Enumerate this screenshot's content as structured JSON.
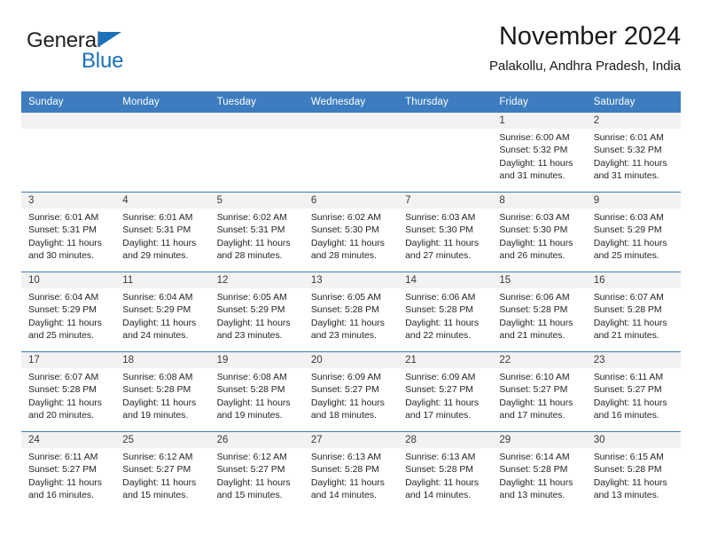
{
  "brand": {
    "name_part1": "General",
    "name_part2": "Blue",
    "triangle_icon": "triangle-icon",
    "color_dark": "#231f20",
    "color_blue": "#1b71b8"
  },
  "header": {
    "title": "November 2024",
    "subtitle": "Palakollu, Andhra Pradesh, India"
  },
  "theme": {
    "header_blue": "#3d7dbf",
    "daynum_band": "#f2f2f2",
    "text": "#262626"
  },
  "calendar": {
    "weekday_headers": [
      "Sunday",
      "Monday",
      "Tuesday",
      "Wednesday",
      "Thursday",
      "Friday",
      "Saturday"
    ],
    "weeks": [
      [
        {
          "day": "",
          "lines": []
        },
        {
          "day": "",
          "lines": []
        },
        {
          "day": "",
          "lines": []
        },
        {
          "day": "",
          "lines": []
        },
        {
          "day": "",
          "lines": []
        },
        {
          "day": "1",
          "lines": [
            "Sunrise: 6:00 AM",
            "Sunset: 5:32 PM",
            "Daylight: 11 hours",
            "and 31 minutes."
          ]
        },
        {
          "day": "2",
          "lines": [
            "Sunrise: 6:01 AM",
            "Sunset: 5:32 PM",
            "Daylight: 11 hours",
            "and 31 minutes."
          ]
        }
      ],
      [
        {
          "day": "3",
          "lines": [
            "Sunrise: 6:01 AM",
            "Sunset: 5:31 PM",
            "Daylight: 11 hours",
            "and 30 minutes."
          ]
        },
        {
          "day": "4",
          "lines": [
            "Sunrise: 6:01 AM",
            "Sunset: 5:31 PM",
            "Daylight: 11 hours",
            "and 29 minutes."
          ]
        },
        {
          "day": "5",
          "lines": [
            "Sunrise: 6:02 AM",
            "Sunset: 5:31 PM",
            "Daylight: 11 hours",
            "and 28 minutes."
          ]
        },
        {
          "day": "6",
          "lines": [
            "Sunrise: 6:02 AM",
            "Sunset: 5:30 PM",
            "Daylight: 11 hours",
            "and 28 minutes."
          ]
        },
        {
          "day": "7",
          "lines": [
            "Sunrise: 6:03 AM",
            "Sunset: 5:30 PM",
            "Daylight: 11 hours",
            "and 27 minutes."
          ]
        },
        {
          "day": "8",
          "lines": [
            "Sunrise: 6:03 AM",
            "Sunset: 5:30 PM",
            "Daylight: 11 hours",
            "and 26 minutes."
          ]
        },
        {
          "day": "9",
          "lines": [
            "Sunrise: 6:03 AM",
            "Sunset: 5:29 PM",
            "Daylight: 11 hours",
            "and 25 minutes."
          ]
        }
      ],
      [
        {
          "day": "10",
          "lines": [
            "Sunrise: 6:04 AM",
            "Sunset: 5:29 PM",
            "Daylight: 11 hours",
            "and 25 minutes."
          ]
        },
        {
          "day": "11",
          "lines": [
            "Sunrise: 6:04 AM",
            "Sunset: 5:29 PM",
            "Daylight: 11 hours",
            "and 24 minutes."
          ]
        },
        {
          "day": "12",
          "lines": [
            "Sunrise: 6:05 AM",
            "Sunset: 5:29 PM",
            "Daylight: 11 hours",
            "and 23 minutes."
          ]
        },
        {
          "day": "13",
          "lines": [
            "Sunrise: 6:05 AM",
            "Sunset: 5:28 PM",
            "Daylight: 11 hours",
            "and 23 minutes."
          ]
        },
        {
          "day": "14",
          "lines": [
            "Sunrise: 6:06 AM",
            "Sunset: 5:28 PM",
            "Daylight: 11 hours",
            "and 22 minutes."
          ]
        },
        {
          "day": "15",
          "lines": [
            "Sunrise: 6:06 AM",
            "Sunset: 5:28 PM",
            "Daylight: 11 hours",
            "and 21 minutes."
          ]
        },
        {
          "day": "16",
          "lines": [
            "Sunrise: 6:07 AM",
            "Sunset: 5:28 PM",
            "Daylight: 11 hours",
            "and 21 minutes."
          ]
        }
      ],
      [
        {
          "day": "17",
          "lines": [
            "Sunrise: 6:07 AM",
            "Sunset: 5:28 PM",
            "Daylight: 11 hours",
            "and 20 minutes."
          ]
        },
        {
          "day": "18",
          "lines": [
            "Sunrise: 6:08 AM",
            "Sunset: 5:28 PM",
            "Daylight: 11 hours",
            "and 19 minutes."
          ]
        },
        {
          "day": "19",
          "lines": [
            "Sunrise: 6:08 AM",
            "Sunset: 5:28 PM",
            "Daylight: 11 hours",
            "and 19 minutes."
          ]
        },
        {
          "day": "20",
          "lines": [
            "Sunrise: 6:09 AM",
            "Sunset: 5:27 PM",
            "Daylight: 11 hours",
            "and 18 minutes."
          ]
        },
        {
          "day": "21",
          "lines": [
            "Sunrise: 6:09 AM",
            "Sunset: 5:27 PM",
            "Daylight: 11 hours",
            "and 17 minutes."
          ]
        },
        {
          "day": "22",
          "lines": [
            "Sunrise: 6:10 AM",
            "Sunset: 5:27 PM",
            "Daylight: 11 hours",
            "and 17 minutes."
          ]
        },
        {
          "day": "23",
          "lines": [
            "Sunrise: 6:11 AM",
            "Sunset: 5:27 PM",
            "Daylight: 11 hours",
            "and 16 minutes."
          ]
        }
      ],
      [
        {
          "day": "24",
          "lines": [
            "Sunrise: 6:11 AM",
            "Sunset: 5:27 PM",
            "Daylight: 11 hours",
            "and 16 minutes."
          ]
        },
        {
          "day": "25",
          "lines": [
            "Sunrise: 6:12 AM",
            "Sunset: 5:27 PM",
            "Daylight: 11 hours",
            "and 15 minutes."
          ]
        },
        {
          "day": "26",
          "lines": [
            "Sunrise: 6:12 AM",
            "Sunset: 5:27 PM",
            "Daylight: 11 hours",
            "and 15 minutes."
          ]
        },
        {
          "day": "27",
          "lines": [
            "Sunrise: 6:13 AM",
            "Sunset: 5:28 PM",
            "Daylight: 11 hours",
            "and 14 minutes."
          ]
        },
        {
          "day": "28",
          "lines": [
            "Sunrise: 6:13 AM",
            "Sunset: 5:28 PM",
            "Daylight: 11 hours",
            "and 14 minutes."
          ]
        },
        {
          "day": "29",
          "lines": [
            "Sunrise: 6:14 AM",
            "Sunset: 5:28 PM",
            "Daylight: 11 hours",
            "and 13 minutes."
          ]
        },
        {
          "day": "30",
          "lines": [
            "Sunrise: 6:15 AM",
            "Sunset: 5:28 PM",
            "Daylight: 11 hours",
            "and 13 minutes."
          ]
        }
      ]
    ]
  }
}
